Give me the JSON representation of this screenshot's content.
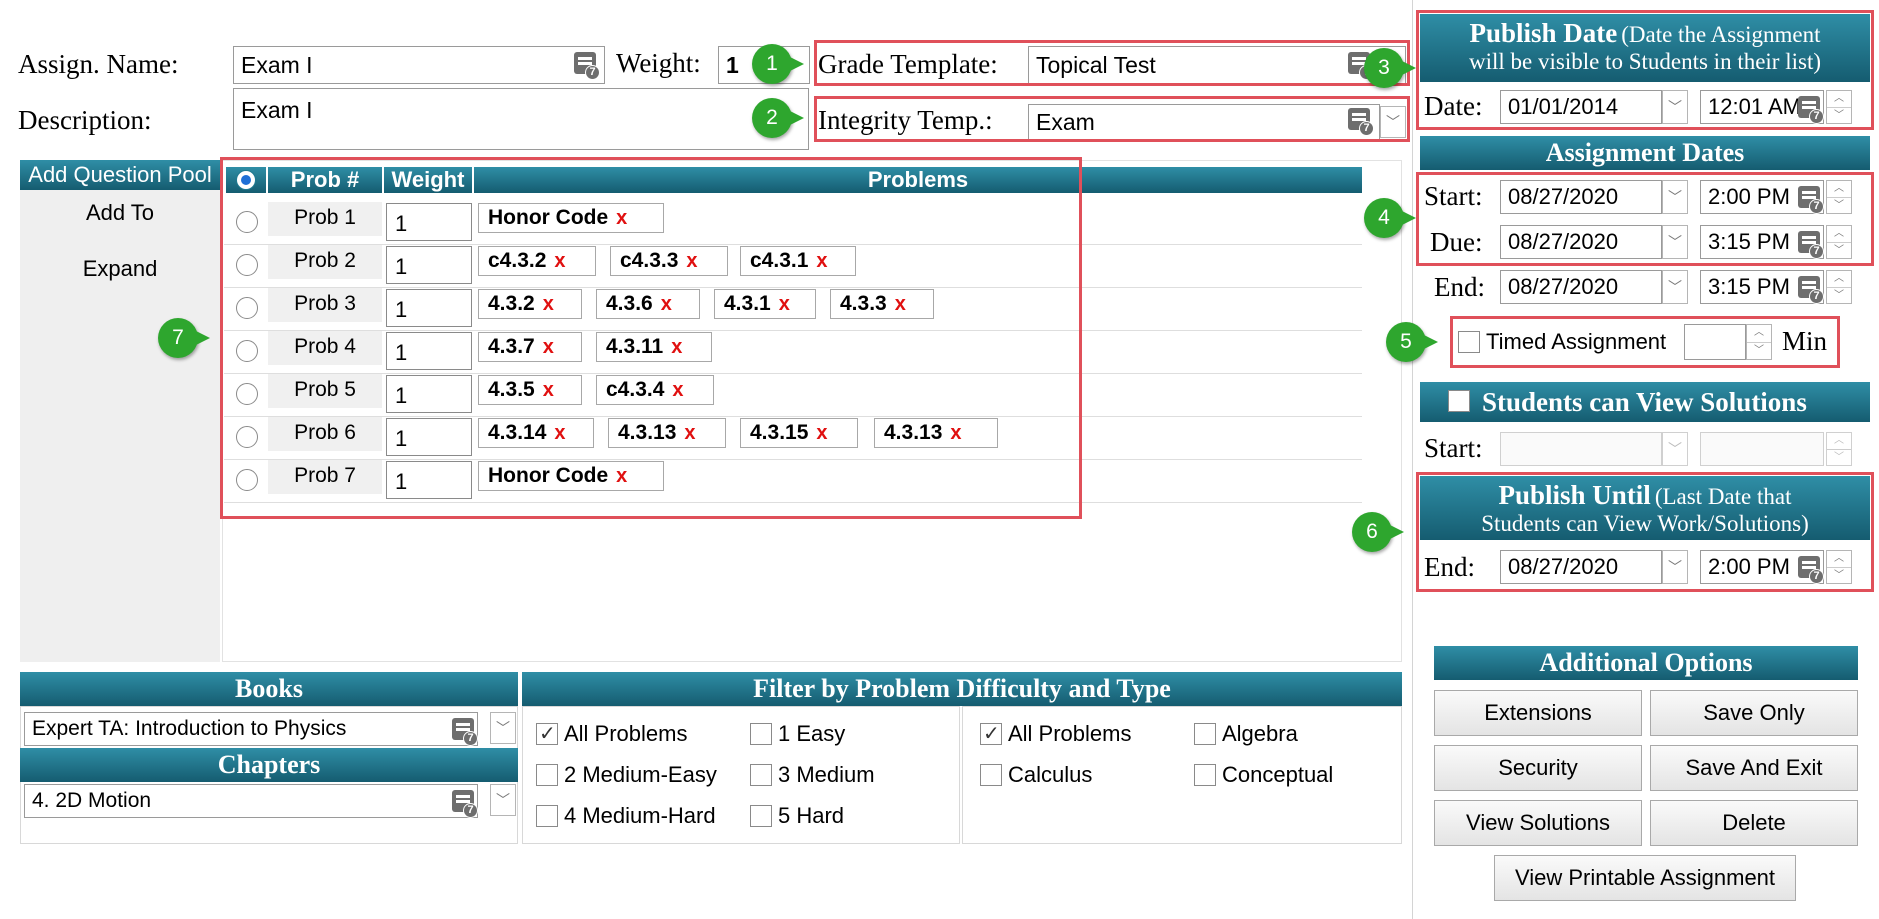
{
  "assign": {
    "name_label": "Assign. Name:",
    "name_value": "Exam I",
    "description_label": "Description:",
    "description_value": "Exam I",
    "weight_label": "Weight:",
    "weight_value": "1"
  },
  "templates": {
    "grade_label": "Grade Template:",
    "grade_value": "Topical Test",
    "integrity_label": "Integrity Temp.:",
    "integrity_value": "Exam"
  },
  "left_menu": {
    "items": [
      "Add Question Pool",
      "Add To",
      "Expand"
    ]
  },
  "problems_table": {
    "headers": {
      "prob": "Prob #",
      "weight": "Weight",
      "problems": "Problems"
    },
    "rows": [
      {
        "label": "Prob 1",
        "weight": "1",
        "chips": [
          "Honor Code"
        ]
      },
      {
        "label": "Prob 2",
        "weight": "1",
        "chips": [
          "c4.3.2",
          "c4.3.3",
          "c4.3.1"
        ]
      },
      {
        "label": "Prob 3",
        "weight": "1",
        "chips": [
          "4.3.2",
          "4.3.6",
          "4.3.1",
          "4.3.3"
        ]
      },
      {
        "label": "Prob 4",
        "weight": "1",
        "chips": [
          "4.3.7",
          "4.3.11"
        ]
      },
      {
        "label": "Prob 5",
        "weight": "1",
        "chips": [
          "4.3.5",
          "c4.3.4"
        ]
      },
      {
        "label": "Prob 6",
        "weight": "1",
        "chips": [
          "4.3.14",
          "4.3.13",
          "4.3.15",
          "4.3.13"
        ]
      },
      {
        "label": "Prob 7",
        "weight": "1",
        "chips": [
          "Honor Code"
        ]
      }
    ],
    "remove_glyph": "x"
  },
  "books": {
    "title": "Books",
    "value": "Expert TA:  Introduction to Physics",
    "chapters_title": "Chapters",
    "chapter_value": "4. 2D Motion"
  },
  "filter": {
    "title": "Filter by Problem Difficulty and Type",
    "difficulty": [
      {
        "label": "All Problems",
        "checked": true
      },
      {
        "label": "1 Easy",
        "checked": false
      },
      {
        "label": "2 Medium-Easy",
        "checked": false
      },
      {
        "label": "3 Medium",
        "checked": false
      },
      {
        "label": "4 Medium-Hard",
        "checked": false
      },
      {
        "label": "5 Hard",
        "checked": false
      }
    ],
    "type": [
      {
        "label": "All Problems",
        "checked": true
      },
      {
        "label": "Algebra",
        "checked": false
      },
      {
        "label": "Calculus",
        "checked": false
      },
      {
        "label": "Conceptual",
        "checked": false
      }
    ]
  },
  "publish_date": {
    "title": "Publish Date",
    "note_line1": "(Date the Assignment",
    "note_line2": "will be visible to Students in their list)",
    "date_label": "Date:",
    "date_value": "01/01/2014",
    "time_value": "12:01 AM"
  },
  "assignment_dates": {
    "title": "Assignment Dates",
    "start_label": "Start:",
    "start_date": "08/27/2020",
    "start_time": "2:00 PM",
    "due_label": "Due:",
    "due_date": "08/27/2020",
    "due_time": "3:15 PM",
    "end_label": "End:",
    "end_date": "08/27/2020",
    "end_time": "3:15 PM"
  },
  "timed": {
    "label": "Timed Assignment",
    "value": "",
    "unit": "Min",
    "checked": false
  },
  "solutions": {
    "title": "Students can View Solutions",
    "checked": false,
    "start_label": "Start:"
  },
  "publish_until": {
    "title": "Publish Until",
    "note_line1": "(Last Date that",
    "note_line2": "Students can View Work/Solutions)",
    "end_label": "End:",
    "end_date": "08/27/2020",
    "end_time": "2:00 PM"
  },
  "additional": {
    "title": "Additional Options",
    "buttons": [
      "Extensions",
      "Save Only",
      "Security",
      "Save And Exit",
      "View Solutions",
      "Delete"
    ],
    "print_button": "View Printable Assignment"
  },
  "callouts": [
    "1",
    "2",
    "3",
    "4",
    "5",
    "6",
    "7"
  ],
  "colors": {
    "accent": "#1f7a91",
    "callout": "#2ea62e",
    "highlight": "#e0505a",
    "remove": "#e01010"
  }
}
